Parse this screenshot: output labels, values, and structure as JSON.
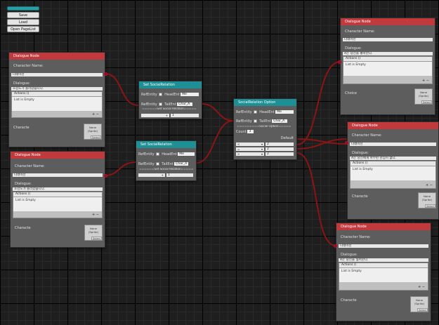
{
  "toolbar": {
    "save": "Save",
    "load": "Load",
    "open": "Open PageList"
  },
  "dialogue_node": {
    "title": "Dialogue Node",
    "character_label": "Character Name:",
    "dialogue_label": "Dialogue:",
    "actions_label": "Actions ()",
    "list_empty": "List is Empty",
    "plus": "+",
    "minus": "−",
    "choice_label": "Choice",
    "character_img_label": "Characte",
    "sprite_none": "None",
    "sprite_type": "(Sprite)",
    "sprite_select": "Select"
  },
  "nodes": {
    "d1": {
      "name": "나래이션",
      "dialogue": "호감도가 올라갔습니다."
    },
    "d2": {
      "name": "나래이션",
      "dialogue": "호감도가 올라갔습니다."
    },
    "d3": {
      "name": "나래이션",
      "dialogue": "A는 당신을 좋아한다."
    },
    "d4": {
      "name": "나래이션",
      "dialogue": "A는 당신에게 아무런 관심이 없다."
    },
    "d5": {
      "name": "나래이션",
      "dialogue": "A는 당신을 싫어한다."
    }
  },
  "social_node": {
    "title": "Set SocialRelation",
    "refentity": "RefEntity",
    "headent": "HeadEnt",
    "head_value": "Me",
    "tailent": "TailEnt",
    "tail_value": "Char_A",
    "separator": "======Set Social Relation=====",
    "dropdown": "+",
    "value": "1"
  },
  "option_node": {
    "title": "SocialRelation Option",
    "refentity": "RefEntity",
    "headent": "HeadEnt",
    "head_value": "Me",
    "tailent": "TailEnt",
    "tail_value": "Char_A",
    "separator": "=========Social Option=====",
    "count_label": "Count",
    "count_value": "3",
    "default_label": "Default",
    "options": [
      {
        "op": "<",
        "value": "2"
      },
      {
        "op": "=",
        "value": "2"
      },
      {
        "op": ">",
        "value": "2"
      }
    ]
  },
  "colors": {
    "dialogue_header": "#c0393d",
    "social_header": "#1d8f95",
    "wire": "#8b1414",
    "canvas": "#1e1e1e"
  }
}
